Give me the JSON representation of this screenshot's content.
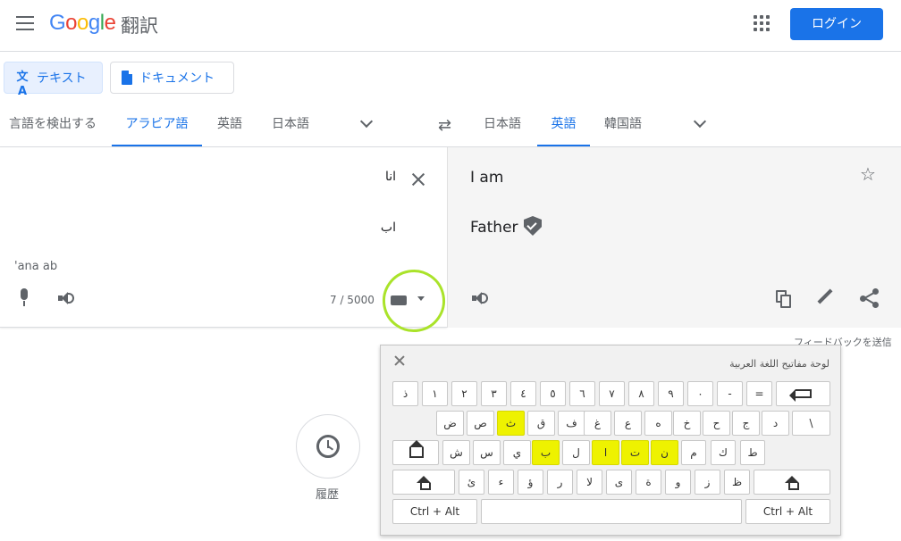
{
  "header": {
    "logo_letters": [
      "G",
      "o",
      "o",
      "g",
      "l",
      "e"
    ],
    "product": "翻訳",
    "login_label": "ログイン"
  },
  "modes": {
    "text_label": "テキスト",
    "document_label": "ドキュメント",
    "text_icon_glyph": "文A"
  },
  "source_langs": {
    "detect": "言語を検出する",
    "tabs": [
      "アラビア語",
      "英語",
      "日本語"
    ]
  },
  "target_langs": {
    "tabs": [
      "日本語",
      "英語",
      "韓国語"
    ]
  },
  "source": {
    "line1": "انا",
    "line2": "اب",
    "transliteration": "'ana ab",
    "char_count": "7 / 5000"
  },
  "target": {
    "line1": "I am",
    "line2": "Father",
    "star_glyph": "☆"
  },
  "feedback": "フィードバックを送信",
  "history_label": "履歴",
  "keyboard": {
    "title": "لوحة مفاتيح اللغة العربية",
    "row1": [
      "ذ",
      "١",
      "٢",
      "٣",
      "٤",
      "٥",
      "٦",
      "٧",
      "٨",
      "٩",
      "٠",
      "-",
      "="
    ],
    "row2": [
      "ض",
      "ص",
      "ث",
      "ق",
      "ف",
      "غ",
      "ع",
      "ه",
      "خ",
      "ح",
      "ج",
      "د",
      "\\"
    ],
    "row3": [
      "ش",
      "س",
      "ي",
      "ب",
      "ل",
      "ا",
      "ت",
      "ن",
      "م",
      "ك",
      "ط"
    ],
    "row4": [
      "ئ",
      "ء",
      "ؤ",
      "ر",
      "لا",
      "ى",
      "ة",
      "و",
      "ز",
      "ظ"
    ],
    "ctrl_alt": "Ctrl + Alt",
    "highlight_color": "#eef200",
    "annotation_color": "#aae32a"
  },
  "colors": {
    "accent": "#1a73e8",
    "icon": "#5f6368"
  }
}
